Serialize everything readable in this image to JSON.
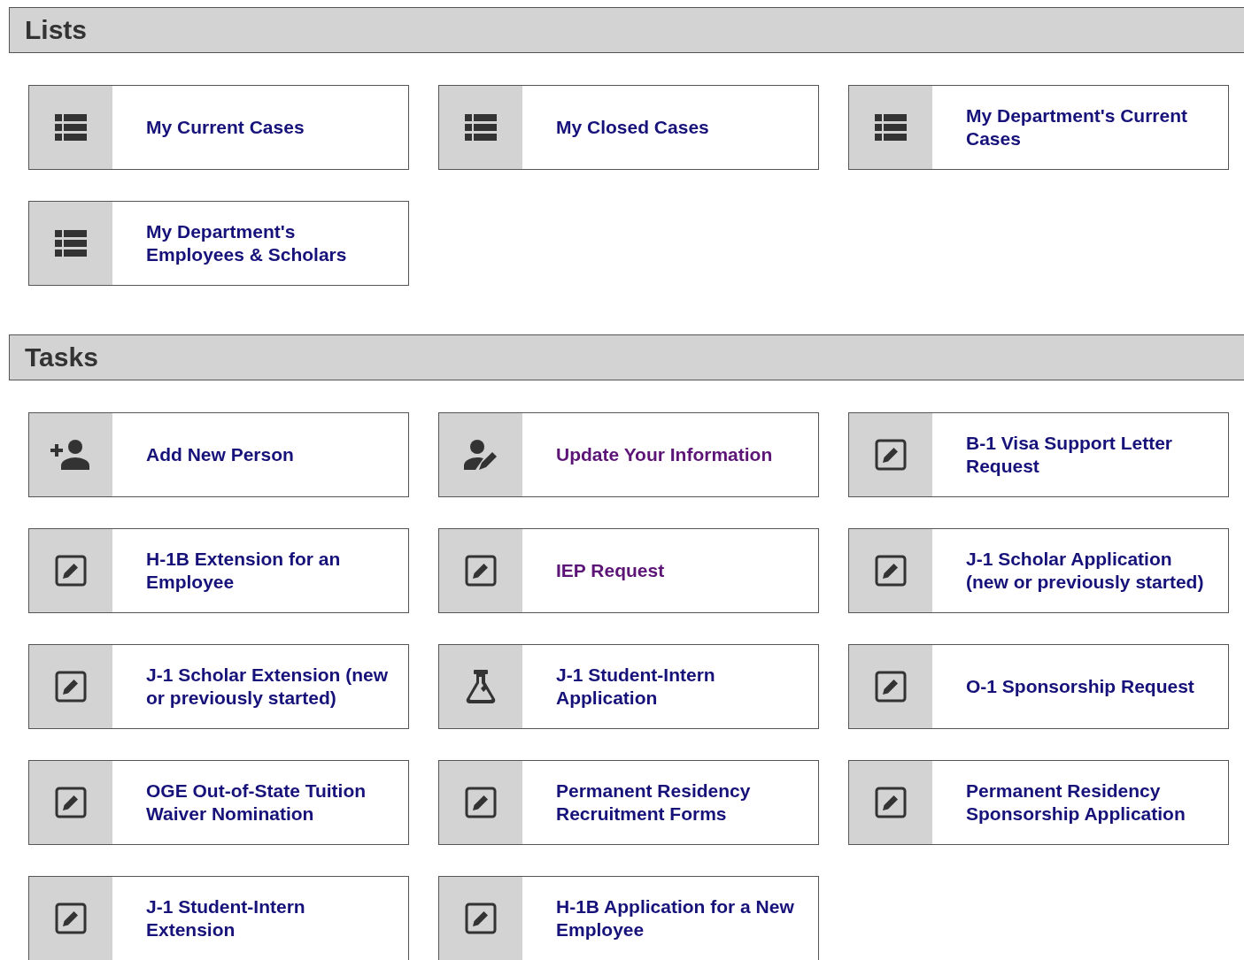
{
  "sections": [
    {
      "title": "Lists",
      "tiles": [
        {
          "kind": "list",
          "label": "My Current Cases",
          "visited": false
        },
        {
          "kind": "list",
          "label": "My Closed Cases",
          "visited": false
        },
        {
          "kind": "list",
          "label": "My Department's Current Cases",
          "visited": false
        },
        {
          "kind": "list",
          "label": "My Department's Employees & Scholars",
          "visited": false
        }
      ]
    },
    {
      "title": "Tasks",
      "tiles": [
        {
          "kind": "add-person",
          "label": "Add New Person",
          "visited": false
        },
        {
          "kind": "edit-person",
          "label": "Update Your Information",
          "visited": true
        },
        {
          "kind": "edit",
          "label": "B-1 Visa Support Letter Request",
          "visited": false
        },
        {
          "kind": "edit",
          "label": "H-1B Extension for an Employee",
          "visited": false
        },
        {
          "kind": "edit",
          "label": "IEP Request",
          "visited": true
        },
        {
          "kind": "edit",
          "label": "J-1 Scholar Application (new or previously started)",
          "visited": false
        },
        {
          "kind": "edit",
          "label": "J-1 Scholar Extension (new or previously started)",
          "visited": false
        },
        {
          "kind": "flask",
          "label": "J-1 Student-Intern Application",
          "visited": false
        },
        {
          "kind": "edit",
          "label": "O-1 Sponsorship Request",
          "visited": false
        },
        {
          "kind": "edit",
          "label": "OGE Out-of-State Tuition Waiver Nomination",
          "visited": false
        },
        {
          "kind": "edit",
          "label": "Permanent Residency Recruitment Forms",
          "visited": false
        },
        {
          "kind": "edit",
          "label": "Permanent Residency Sponsorship Application",
          "visited": false
        },
        {
          "kind": "edit",
          "label": "J-1 Student-Intern Extension",
          "visited": false
        },
        {
          "kind": "edit",
          "label": "H-1B Application for a New Employee",
          "visited": false
        }
      ]
    }
  ]
}
